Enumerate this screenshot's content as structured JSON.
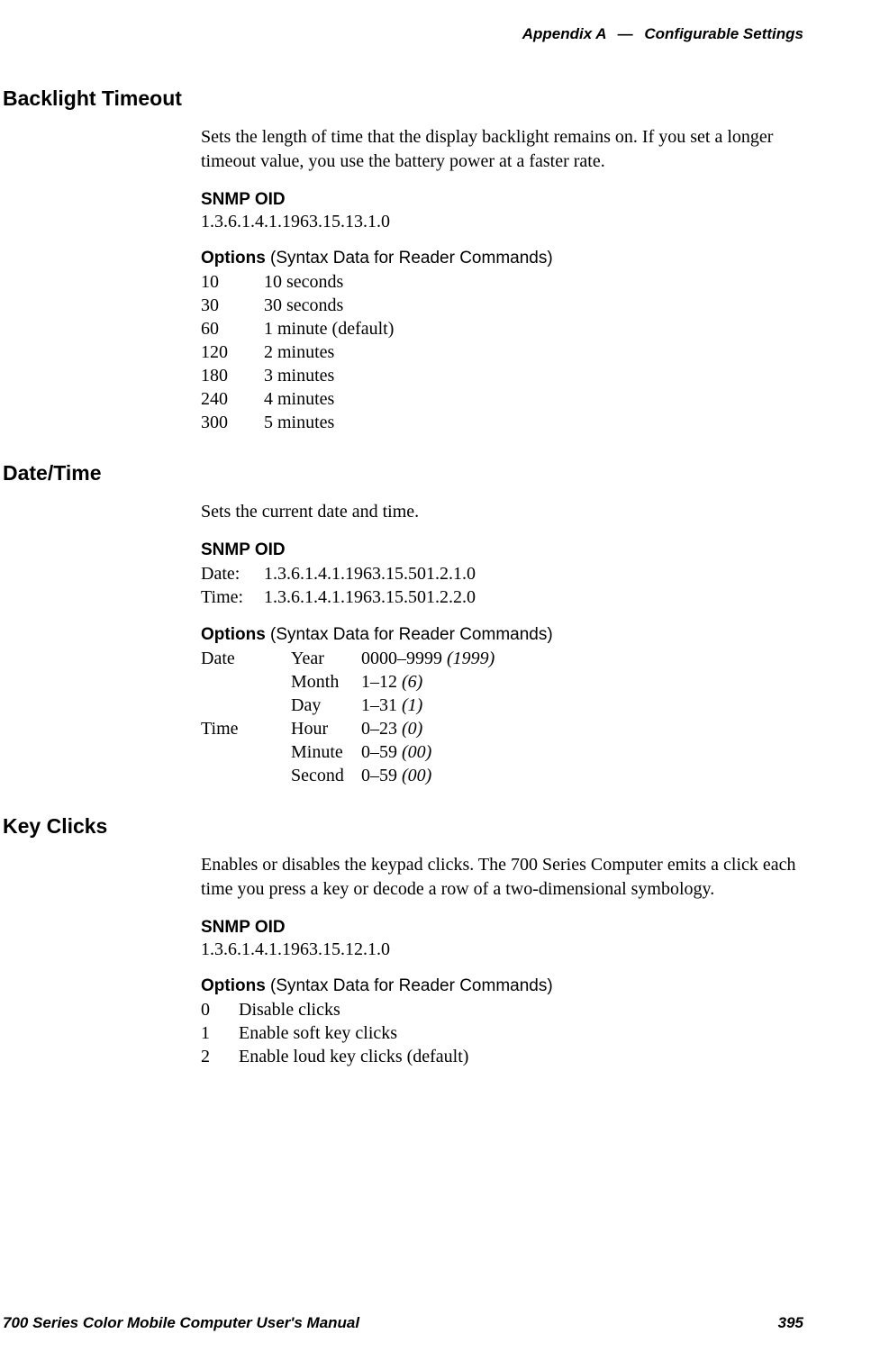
{
  "header": {
    "appendix": "Appendix A",
    "dash": "—",
    "title": "Configurable Settings"
  },
  "sections": {
    "backlight": {
      "heading": "Backlight Timeout",
      "description": "Sets the length of time that the display backlight remains on. If you set a longer timeout value, you use the battery power at a faster rate.",
      "snmp_label": "SNMP OID",
      "snmp_oid": "1.3.6.1.4.1.1963.15.13.1.0",
      "options_label_bold": "Options",
      "options_label_rest": " (Syntax Data for Reader Commands)",
      "options": [
        {
          "code": "10",
          "desc": "10 seconds"
        },
        {
          "code": "30",
          "desc": "30 seconds"
        },
        {
          "code": "60",
          "desc": "1 minute (default)"
        },
        {
          "code": "120",
          "desc": "2 minutes"
        },
        {
          "code": "180",
          "desc": "3 minutes"
        },
        {
          "code": "240",
          "desc": "4 minutes"
        },
        {
          "code": "300",
          "desc": "5 minutes"
        }
      ]
    },
    "datetime": {
      "heading": "Date/Time",
      "description": "Sets the current date and time.",
      "snmp_label": "SNMP OID",
      "snmp_rows": [
        {
          "label": "Date:",
          "value": "1.3.6.1.4.1.1963.15.501.2.1.0"
        },
        {
          "label": "Time:",
          "value": "1.3.6.1.4.1.1963.15.501.2.2.0"
        }
      ],
      "options_label_bold": "Options",
      "options_label_rest": " (Syntax Data for Reader Commands)",
      "options": [
        {
          "group": "Date",
          "field": "Year",
          "range": "0000–9999",
          "def": "(1999)"
        },
        {
          "group": "",
          "field": "Month",
          "range": "1–12",
          "def": "(6)"
        },
        {
          "group": "",
          "field": "Day",
          "range": "1–31",
          "def": "(1)"
        },
        {
          "group": "Time",
          "field": "Hour",
          "range": "0–23",
          "def": "(0)"
        },
        {
          "group": "",
          "field": "Minute",
          "range": "0–59",
          "def": "(00)"
        },
        {
          "group": "",
          "field": "Second",
          "range": "0–59",
          "def": "(00)"
        }
      ]
    },
    "keyclicks": {
      "heading": "Key Clicks",
      "description": "Enables or disables the keypad clicks. The 700 Series Computer emits a click each time you press a key or decode a row of a two-dimensional symbology.",
      "snmp_label": "SNMP OID",
      "snmp_oid": "1.3.6.1.4.1.1963.15.12.1.0",
      "options_label_bold": "Options",
      "options_label_rest": " (Syntax Data for Reader Commands)",
      "options": [
        {
          "code": "0",
          "desc": "Disable clicks"
        },
        {
          "code": "1",
          "desc": "Enable soft key clicks"
        },
        {
          "code": "2",
          "desc": "Enable loud key clicks (default)"
        }
      ]
    }
  },
  "footer": {
    "left": "700 Series Color Mobile Computer User's Manual",
    "right": "395"
  }
}
